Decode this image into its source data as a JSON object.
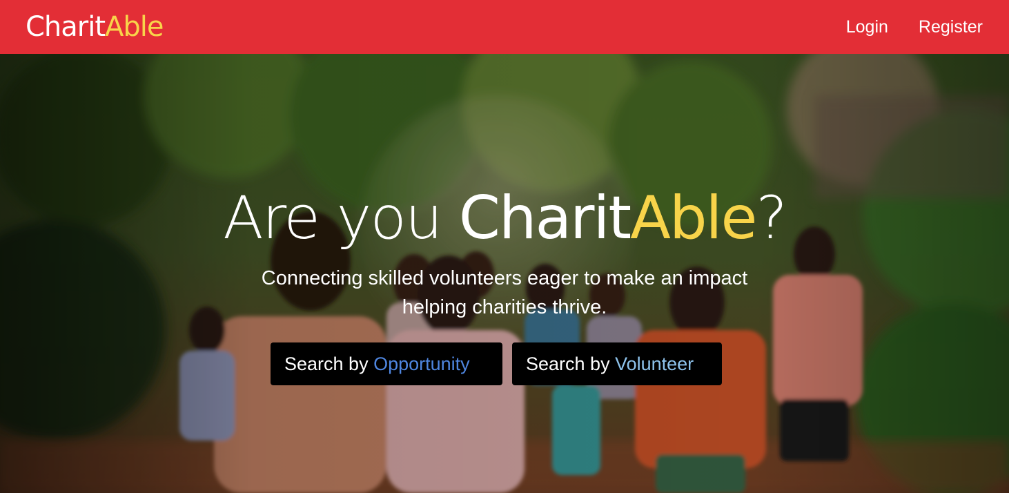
{
  "navbar": {
    "brand_part1": "Charit",
    "brand_part2": "Able",
    "links": [
      {
        "label": "Login"
      },
      {
        "label": "Register"
      }
    ]
  },
  "hero": {
    "title_part1": "Are you ",
    "title_part2": "Charit",
    "title_part3": "Able",
    "title_part4": "?",
    "subtitle_line1": "Connecting skilled volunteers eager to make an impact",
    "subtitle_line2": "helping charities thrive.",
    "buttons": [
      {
        "prefix": "Search by ",
        "highlight": "Opportunity"
      },
      {
        "prefix": "Search by ",
        "highlight": "Volunteer"
      }
    ],
    "image": "children-running-photo"
  },
  "colors": {
    "navbar_bg": "#e32e36",
    "accent_yellow": "#f8d44a",
    "opportunity_blue": "#4f86e0",
    "volunteer_blue": "#8ec3ec",
    "button_bg": "#000000"
  }
}
